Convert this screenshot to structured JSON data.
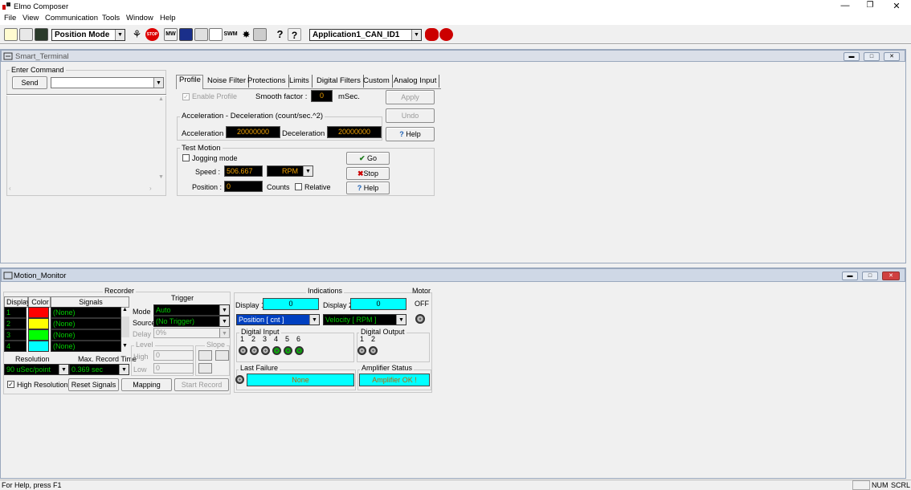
{
  "app": {
    "title": "Elmo Composer",
    "icon": "elmo-app-icon"
  },
  "menu": [
    "File",
    "View",
    "Communication",
    "Tools",
    "Window",
    "Help"
  ],
  "toolbar": {
    "mode": "Position Mode",
    "application": "Application1_CAN_ID1"
  },
  "terminal": {
    "title": "Smart_Terminal",
    "enter_command": "Enter Command",
    "send": "Send",
    "command_value": "",
    "tabs": [
      "Profile",
      "Noise Filter",
      "Protections",
      "Limits",
      "Digital Filters",
      "Custom",
      "Analog Input"
    ],
    "enable_profile": "Enable Profile",
    "smooth_factor_label": "Smooth factor :",
    "smooth_factor": "0",
    "msec": "mSec.",
    "apply": "Apply",
    "undo": "Undo",
    "help": "Help",
    "accel_group": "Acceleration - Deceleration (count/sec.^2)",
    "accel_label": "Acceleration :",
    "accel": "20000000",
    "decel_label": "Deceleration :",
    "decel": "20000000",
    "test_motion": "Test Motion",
    "jogging": "Jogging mode",
    "speed_label": "Speed :",
    "speed": "506.667",
    "speed_unit": "RPM",
    "position_label": "Position :",
    "position": "0",
    "counts": "Counts",
    "relative": "Relative",
    "go": "Go",
    "stop": "Stop"
  },
  "monitor": {
    "title": "Motion_Monitor",
    "recorder": "Recorder",
    "headers": [
      "Display",
      "Color",
      "Signals"
    ],
    "rows": [
      {
        "n": "1",
        "color": "#ff0000",
        "signal": "(None)"
      },
      {
        "n": "2",
        "color": "#ffff00",
        "signal": "(None)"
      },
      {
        "n": "3",
        "color": "#00ff00",
        "signal": "(None)"
      },
      {
        "n": "4",
        "color": "#00ffff",
        "signal": "(None)"
      }
    ],
    "resolution_label": "Resolution",
    "resolution": "90 uSec/point",
    "max_record_label": "Max. Record Time",
    "max_record": "0.369 sec",
    "high_resolution": "High Resolution",
    "reset_signals": "Reset Signals",
    "mapping": "Mapping",
    "start_record": "Start Record",
    "trigger": "Trigger",
    "mode_label": "Mode",
    "mode": "Auto",
    "source_label": "Source",
    "source": "(No Trigger)",
    "delay_label": "Delay",
    "delay": "0%",
    "level": "Level",
    "slope": "Slope",
    "high_label": "High",
    "high": "0",
    "low_label": "Low",
    "low": "0",
    "indications": "Indications",
    "display1_label": "Display 1",
    "display1": "0",
    "display2_label": "Display 2",
    "display2": "0",
    "sel1": "Position       [ cnt ]",
    "sel2": "Velocity        [ RPM ]",
    "digital_input": "Digital Input",
    "di_nums": [
      "1",
      "2",
      "3",
      "4",
      "5",
      "6"
    ],
    "digital_output": "Digital Output",
    "do_nums": [
      "1",
      "2"
    ],
    "last_failure": "Last Failure",
    "last_failure_value": "None",
    "amplifier_status": "Amplifier Status",
    "amplifier_value": "Amplifier OK !",
    "motor": "Motor",
    "motor_state": "OFF"
  },
  "status": {
    "help": "For Help, press F1",
    "num": "NUM",
    "scrl": "SCRL"
  }
}
